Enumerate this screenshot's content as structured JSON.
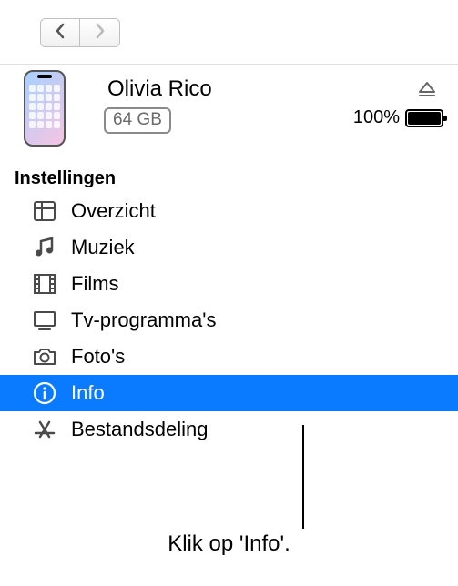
{
  "nav": {
    "back": "Back",
    "forward": "Forward"
  },
  "device": {
    "name": "Olivia Rico",
    "capacity": "64 GB",
    "battery_pct": "100%"
  },
  "section_title": "Instellingen",
  "settings": [
    {
      "key": "overview",
      "label": "Overzicht",
      "icon": "list-icon"
    },
    {
      "key": "music",
      "label": "Muziek",
      "icon": "music-icon"
    },
    {
      "key": "films",
      "label": "Films",
      "icon": "film-icon"
    },
    {
      "key": "tv",
      "label": "Tv-programma's",
      "icon": "tv-icon"
    },
    {
      "key": "photos",
      "label": "Foto's",
      "icon": "camera-icon"
    },
    {
      "key": "info",
      "label": "Info",
      "icon": "info-icon"
    },
    {
      "key": "filesharing",
      "label": "Bestandsdeling",
      "icon": "appstore-icon"
    }
  ],
  "selected_key": "info",
  "callout": "Klik op 'Info'.",
  "colors": {
    "selection": "#0a7bff"
  }
}
